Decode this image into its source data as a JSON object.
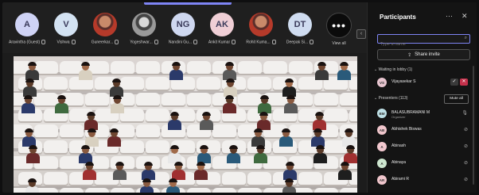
{
  "strip": {
    "tiles": [
      {
        "initials": "A",
        "name": "Aravintha (Guest)",
        "style": "light",
        "color": "#cfd3f5"
      },
      {
        "initials": "V",
        "name": "Vishwa",
        "style": "light",
        "color": "#d3e2f2"
      },
      {
        "initials": "",
        "name": "Guneerkar...",
        "style": "photo",
        "color": "#b63a2a"
      },
      {
        "initials": "",
        "name": "Yogeshwar...",
        "style": "photo2",
        "color": "#888888"
      },
      {
        "initials": "NG",
        "name": "Nandini Gu...",
        "style": "light",
        "color": "#cfd8f0"
      },
      {
        "initials": "AK",
        "name": "Ankit Kumar",
        "style": "light",
        "color": "#f0cfd6"
      },
      {
        "initials": "",
        "name": "Rohit Kuma...",
        "style": "photo",
        "color": "#b63a2a"
      },
      {
        "initials": "DT",
        "name": "Deepak Si...",
        "style": "light",
        "color": "#cfdcf0"
      },
      {
        "initials": "•••",
        "name": "View all",
        "style": "dark",
        "color": "#0b0b0b"
      }
    ]
  },
  "panel": {
    "title": "Participants",
    "search_placeholder": "Type a name",
    "share_label": "Share invite",
    "waiting_header": "Waiting in lobby (1)",
    "lobby": [
      {
        "initials": "VS",
        "name": "Vijayasekar S",
        "color": "#e8c6d0"
      }
    ],
    "presenters_header": "Presenters (113)",
    "mute_all": "Mute all",
    "people": [
      {
        "initials": "BM",
        "name": "BALASUBRAMANI M",
        "sub": "Organizer",
        "color": "#bfe0e6",
        "mic": "on"
      },
      {
        "initials": "AB",
        "name": "Abhishek Biswas",
        "sub": "",
        "color": "#f0c6cc",
        "mic": "off"
      },
      {
        "initials": "A",
        "name": "Abinash",
        "sub": "",
        "color": "#f2c8cf",
        "mic": "off"
      },
      {
        "initials": "A",
        "name": "Abinaya",
        "sub": "",
        "color": "#cde6cf",
        "mic": "off"
      },
      {
        "initials": "AR",
        "name": "Abirami R",
        "sub": "",
        "color": "#f0c6cc",
        "mic": "off"
      }
    ]
  },
  "colors": {
    "accent": "#7f85f5",
    "panel_bg": "#141414"
  }
}
